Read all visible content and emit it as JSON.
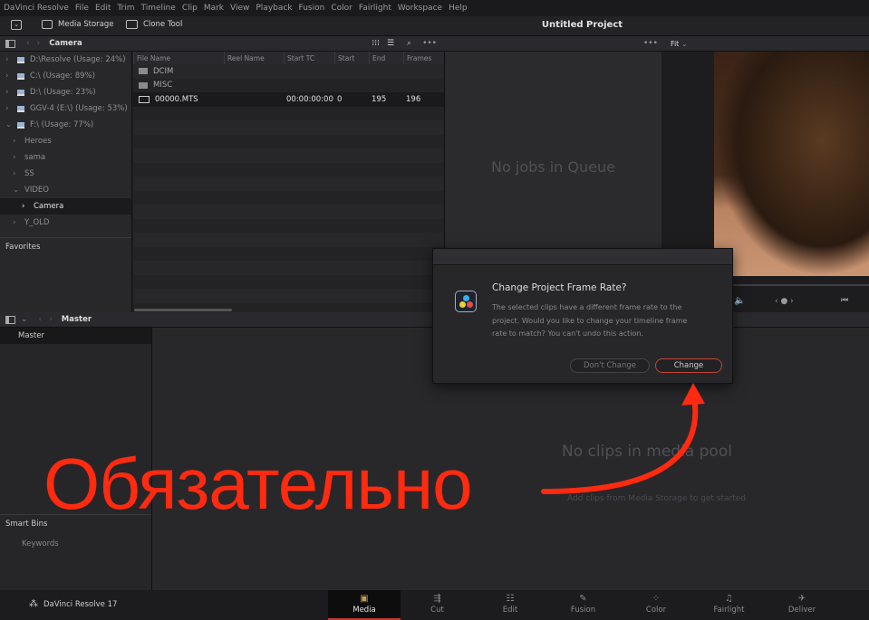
{
  "menu": [
    "DaVinci Resolve",
    "File",
    "Edit",
    "Trim",
    "Timeline",
    "Clip",
    "Mark",
    "View",
    "Playback",
    "Fusion",
    "Color",
    "Fairlight",
    "Workspace",
    "Help"
  ],
  "toolbar": {
    "media_storage": "Media Storage",
    "clone_tool": "Clone Tool",
    "project_title": "Untitled Project"
  },
  "storage": {
    "breadcrumb": "Camera",
    "tree": [
      {
        "label": "D:\\Resolve (Usage: 24%)",
        "type": "drive",
        "expanded": false
      },
      {
        "label": "C:\\ (Usage: 89%)",
        "type": "drive",
        "expanded": false
      },
      {
        "label": "D:\\ (Usage: 23%)",
        "type": "drive",
        "expanded": false
      },
      {
        "label": "GGV-4 (E:\\) (Usage: 53%)",
        "type": "drive",
        "expanded": false
      },
      {
        "label": "F:\\ (Usage: 77%)",
        "type": "drive",
        "expanded": true
      },
      {
        "label": "Heroes",
        "type": "folder"
      },
      {
        "label": "sama",
        "type": "folder"
      },
      {
        "label": "SS",
        "type": "folder"
      },
      {
        "label": "VIDEO",
        "type": "folder",
        "expanded": true
      },
      {
        "label": "Camera",
        "type": "folder",
        "selected": true
      },
      {
        "label": "Y_OLD",
        "type": "folder"
      }
    ],
    "favorites": "Favorites",
    "columns": [
      "File Name",
      "Reel Name",
      "Start TC",
      "Start",
      "End",
      "Frames"
    ],
    "rows": [
      [
        "DCIM",
        "",
        "",
        "",
        "",
        ""
      ],
      [
        "MISC",
        "",
        "",
        "",
        "",
        ""
      ],
      [
        "00000.MTS",
        "",
        "00:00:00:00",
        "0",
        "195",
        "196"
      ]
    ]
  },
  "queue": {
    "empty": "No jobs in Queue"
  },
  "viewer": {
    "zoom": "Fit"
  },
  "pool": {
    "bin_header": "Master",
    "bins": [
      "Master"
    ],
    "smart_bins": "Smart Bins",
    "keywords": "Keywords",
    "empty_title": "No clips in media pool",
    "empty_hint": "Add clips from Media Storage to get started"
  },
  "dialog": {
    "title": "Change Project Frame Rate?",
    "message": "The selected clips have a different frame rate to the project. Would you like to change your timeline frame rate to match? You can't undo this action.",
    "cancel": "Don't Change",
    "confirm": "Change"
  },
  "bottom": {
    "app": "DaVinci Resolve 17",
    "pages": [
      {
        "label": "Media",
        "active": true
      },
      {
        "label": "Cut"
      },
      {
        "label": "Edit"
      },
      {
        "label": "Fusion"
      },
      {
        "label": "Color"
      },
      {
        "label": "Fairlight"
      },
      {
        "label": "Deliver"
      }
    ]
  },
  "annotation": {
    "text": "Обязательно",
    "color": "#ff2a10"
  },
  "colors": {
    "accent": "#c0392b"
  }
}
